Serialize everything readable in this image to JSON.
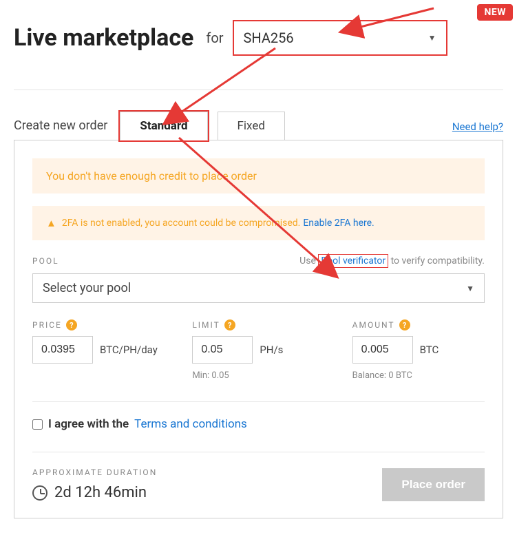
{
  "header": {
    "title": "Live marketplace",
    "for_label": "for",
    "algorithm": "SHA256",
    "new_badge": "NEW"
  },
  "tabs": {
    "create_label": "Create new order",
    "standard": "Standard",
    "fixed": "Fixed",
    "need_help": "Need help?"
  },
  "alerts": {
    "credit": "You don't have enough credit to place order",
    "twofa_text": "2FA is not enabled, you account could be compromised.",
    "twofa_link": "Enable 2FA here."
  },
  "pool": {
    "label": "POOL",
    "verif_prefix": "Use ",
    "verif_link": "Pool verificator",
    "verif_suffix": " to verify compatibility.",
    "placeholder": "Select your pool"
  },
  "price": {
    "label": "PRICE",
    "value": "0.0395",
    "unit": "BTC/PH/day"
  },
  "limit": {
    "label": "LIMIT",
    "value": "0.05",
    "unit": "PH/s",
    "min": "Min: 0.05"
  },
  "amount": {
    "label": "AMOUNT",
    "value": "0.005",
    "unit": "BTC",
    "balance": "Balance: 0 BTC"
  },
  "agree": {
    "text": "I agree with the",
    "link": "Terms and conditions"
  },
  "duration": {
    "label": "APPROXIMATE DURATION",
    "value": "2d 12h 46min"
  },
  "place_button": "Place order"
}
